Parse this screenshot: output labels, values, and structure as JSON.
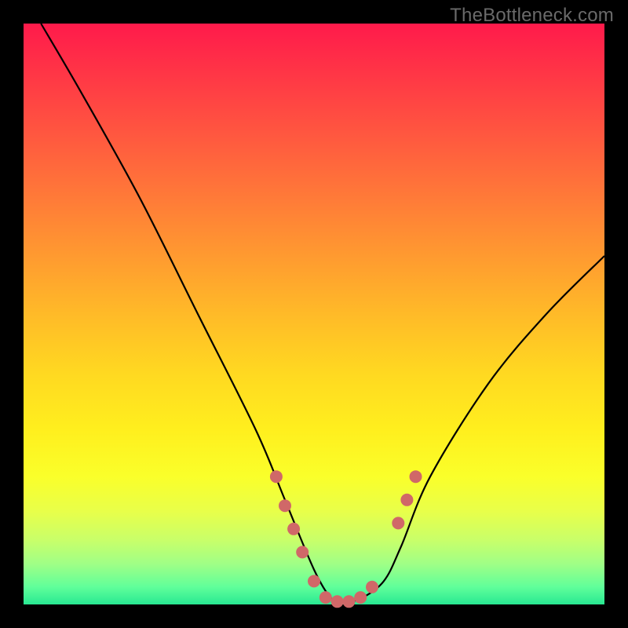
{
  "watermark": "TheBottleneck.com",
  "chart_data": {
    "type": "line",
    "title": "",
    "xlabel": "",
    "ylabel": "",
    "xlim": [
      0,
      100
    ],
    "ylim": [
      0,
      100
    ],
    "series": [
      {
        "name": "curve",
        "x": [
          3,
          10,
          20,
          30,
          40,
          45,
          50,
          53,
          55,
          58,
          62,
          65,
          70,
          80,
          90,
          100
        ],
        "y": [
          100,
          88,
          70,
          50,
          30,
          18,
          6,
          1,
          0.5,
          1,
          4,
          10,
          22,
          38,
          50,
          60
        ]
      }
    ],
    "markers": [
      {
        "x": 43.5,
        "y": 22
      },
      {
        "x": 45.0,
        "y": 17
      },
      {
        "x": 46.5,
        "y": 13
      },
      {
        "x": 48.0,
        "y": 9
      },
      {
        "x": 50.0,
        "y": 4
      },
      {
        "x": 52.0,
        "y": 1.2
      },
      {
        "x": 54.0,
        "y": 0.5
      },
      {
        "x": 56.0,
        "y": 0.5
      },
      {
        "x": 58.0,
        "y": 1.2
      },
      {
        "x": 60.0,
        "y": 3.0
      },
      {
        "x": 64.5,
        "y": 14
      },
      {
        "x": 66.0,
        "y": 18
      },
      {
        "x": 67.5,
        "y": 22
      }
    ],
    "marker_color": "#d06868",
    "marker_radius": 8,
    "curve_color": "#000000",
    "curve_width": 2.2
  }
}
